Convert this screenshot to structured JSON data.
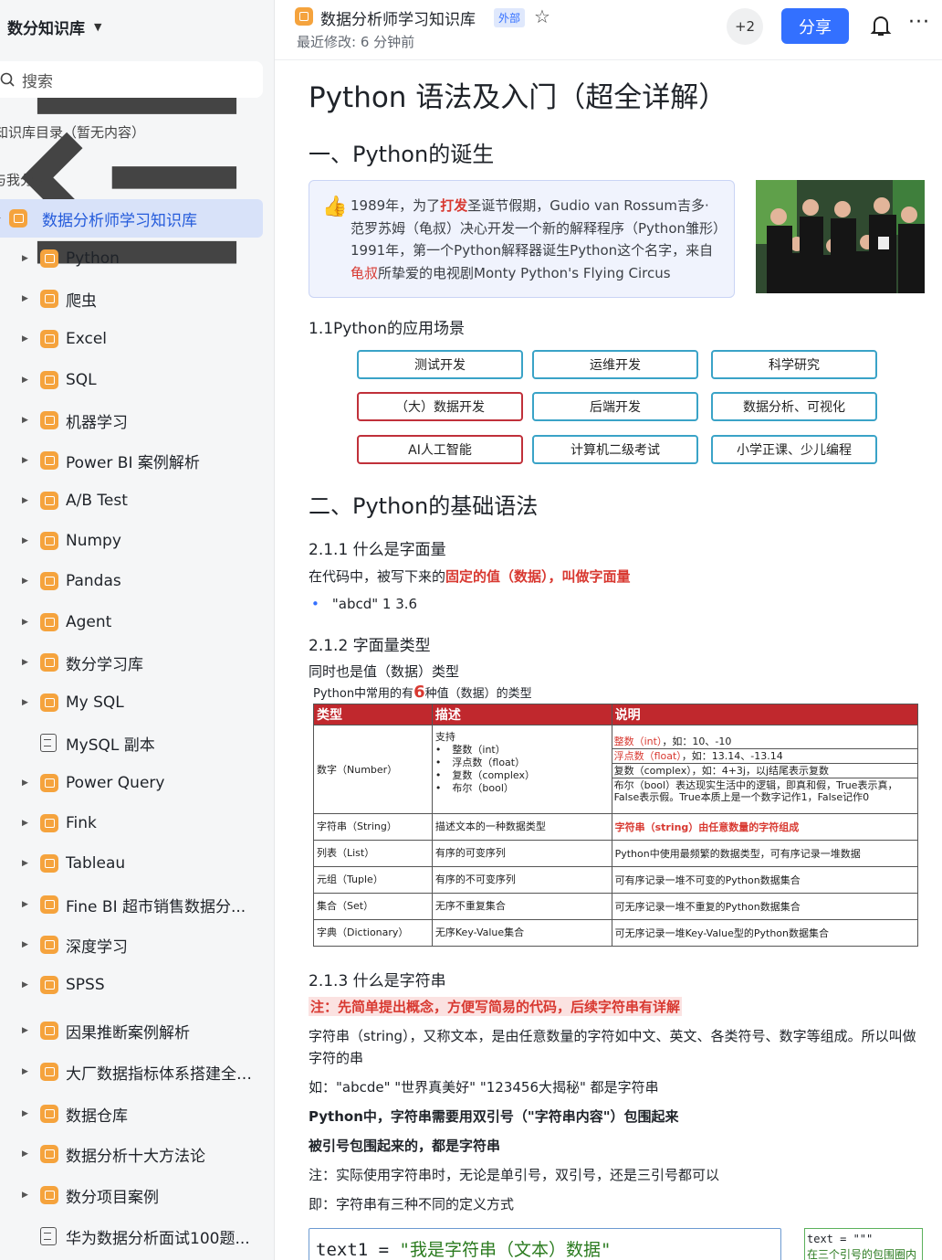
{
  "sidebar": {
    "workspace": "数分知识库",
    "search_placeholder": "搜索",
    "section_catalog": "知识库目录（暂无内容）",
    "section_shared": "与我分享",
    "items": [
      {
        "label": "数据分析师学习知识库",
        "active": true
      },
      {
        "label": "Python"
      },
      {
        "label": "爬虫"
      },
      {
        "label": "Excel"
      },
      {
        "label": "SQL"
      },
      {
        "label": "机器学习"
      },
      {
        "label": "Power BI 案例解析"
      },
      {
        "label": "A/B Test"
      },
      {
        "label": "Numpy"
      },
      {
        "label": "Pandas"
      },
      {
        "label": "Agent"
      },
      {
        "label": "数分学习库"
      },
      {
        "label": "My SQL"
      },
      {
        "label": "MySQL 副本",
        "doc": true
      },
      {
        "label": "Power Query"
      },
      {
        "label": "Fink"
      },
      {
        "label": "Tableau"
      },
      {
        "label": "Fine BI 超市销售数据分..."
      },
      {
        "label": "深度学习"
      },
      {
        "label": "SPSS"
      },
      {
        "label": "因果推断案例解析"
      },
      {
        "label": "大厂数据指标体系搭建全流程"
      },
      {
        "label": "数据仓库"
      },
      {
        "label": "数据分析十大方法论"
      },
      {
        "label": "数分项目案例"
      },
      {
        "label": "华为数据分析面试100题...",
        "doc": true
      }
    ]
  },
  "header": {
    "title": "数据分析师学习知识库",
    "badge": "外部",
    "subtitle": "最近修改: 6 分钟前",
    "collaborators": "+2",
    "share": "分享"
  },
  "doc": {
    "title": "Python 语法及入门（超全详解）",
    "h_birth": "一、Python的诞生",
    "callout": {
      "p1": "1989年，为了",
      "p1_red": "打发",
      "p2": "圣诞节假期，Gudio van Rossum吉多· 范罗苏姆（龟叔）决心开发一个新的解释程序（Python雏形）1991年，第一个Python解释器诞生Python这个名字，来自",
      "p3_red": "龟叔",
      "p4": "所挚爱的电视剧Monty Python's Flying Circus"
    },
    "h_app": "1.1Python的应用场景",
    "apps": [
      "测试开发",
      "运维开发",
      "科学研究",
      "（大）数据开发",
      "后端开发",
      "数据分析、可视化",
      "AI人工智能",
      "计算机二级考试",
      "小学正课、少儿编程"
    ],
    "h_basic": "二、Python的基础语法",
    "h_literal": "2.1.1 什么是字面量",
    "literal_def_a": "在代码中，被写下来的",
    "literal_def_b": "固定的值（数据），叫做字面量",
    "literal_example": "\"abcd\"   1   3.6",
    "h_types": "2.1.2 字面量类型",
    "types_desc": "同时也是值（数据）类型",
    "table_caption_a": "Python中常用的有",
    "table_caption_num": "6",
    "table_caption_b": "种值（数据）的类型",
    "table": {
      "headers": [
        "类型",
        "描述",
        "说明"
      ],
      "number_type": "数字（Number）",
      "number_desc_title": "支持",
      "number_desc": [
        "整数（int）",
        "浮点数（float）",
        "复数（complex）",
        "布尔（bool）"
      ],
      "number_notes": [
        {
          "red": "整数（int）",
          "rest": "，如：10、-10"
        },
        {
          "red": "浮点数（float）",
          "rest": "，如：13.14、-13.14"
        },
        {
          "red": "",
          "rest": "复数（complex），如：4+3j，以j结尾表示复数"
        },
        {
          "red": "",
          "rest": "布尔（bool）表达现实生活中的逻辑，即真和假，True表示真，False表示假。True本质上是一个数字记作1，False记作0"
        }
      ],
      "rows": [
        {
          "type": "字符串（String）",
          "desc": "描述文本的一种数据类型",
          "note": "字符串（string）由任意数量的字符组成",
          "red": true
        },
        {
          "type": "列表（List）",
          "desc": "有序的可变序列",
          "note": "Python中使用最频繁的数据类型，可有序记录一堆数据"
        },
        {
          "type": "元组（Tuple）",
          "desc": "有序的不可变序列",
          "note": "可有序记录一堆不可变的Python数据集合"
        },
        {
          "type": "集合（Set）",
          "desc": "无序不重复集合",
          "note": "可无序记录一堆不重复的Python数据集合"
        },
        {
          "type": "字典（Dictionary）",
          "desc": "无序Key-Value集合",
          "note": "可无序记录一堆Key-Value型的Python数据集合"
        }
      ]
    },
    "h_string": "2.1.3 什么是字符串",
    "string_note": "注：先简单提出概念，方便写简易的代码，后续字符串有详解",
    "string_def_1": "字符串（string），又称文本，是由任意数量的字符如中文、英文、各类符号、数字等组成。所以叫做",
    "string_def_2": "字符的串",
    "string_examples": "如：\"abcde\"   \"世界真美好\"     \"123456大揭秘\"    都是字符串",
    "string_rule": "Python中，字符串需要用双引号（\"字符串内容\"）包围起来",
    "string_rule2": "被引号包围起来的，都是字符串",
    "string_note2": "注：实际使用字符串时，无论是单引号，双引号，还是三引号都可以",
    "string_note3": "即：字符串有三种不同的定义方式",
    "code1_var": "text1  =  ",
    "code1_str": "\"我是字符串（文本）数据\"",
    "code2_line1": "text = \"\"\"",
    "code2_line2": "在三个引号的包围圈内"
  }
}
